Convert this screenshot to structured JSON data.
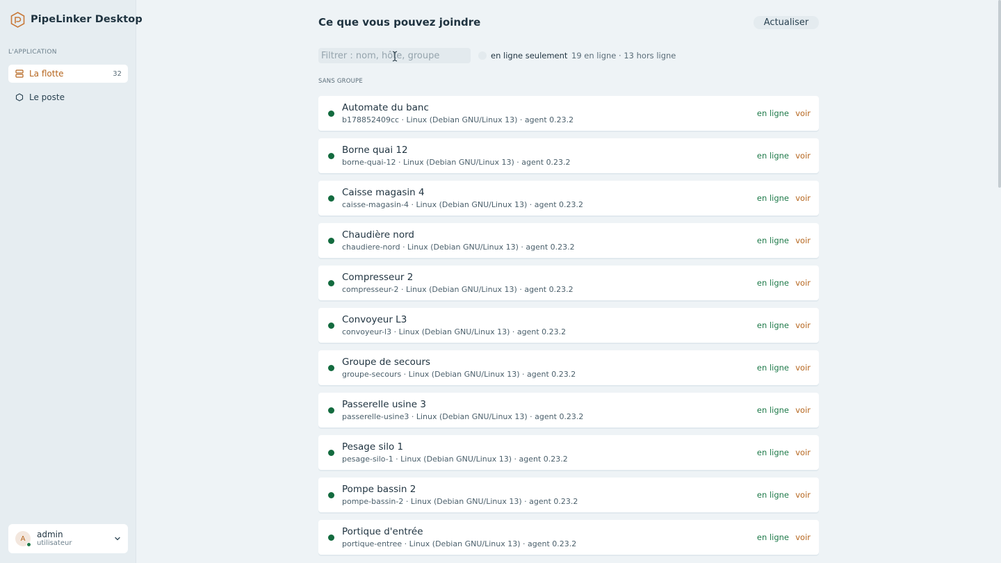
{
  "app": {
    "title": "PipeLinker Desktop"
  },
  "sidebar": {
    "section_label": "L'APPLICATION",
    "items": [
      {
        "label": "La flotte",
        "count": "32",
        "icon": "server-icon",
        "active": true
      },
      {
        "label": "Le poste",
        "icon": "hexagon-icon",
        "active": false
      }
    ],
    "user": {
      "initial": "A",
      "name": "admin",
      "role": "utilisateur"
    }
  },
  "main": {
    "title": "Ce que vous pouvez joindre",
    "refresh_label": "Actualiser",
    "filter": {
      "placeholder": "Filtrer : nom, hôte, groupe",
      "value": ""
    },
    "toggle_label": "en ligne seulement",
    "counts": "19 en ligne · 13 hors ligne",
    "group_header": "SANS GROUPE",
    "devices": [
      {
        "name": "Automate du banc",
        "meta": "b178852409cc · Linux (Debian GNU/Linux 13) · agent 0.23.2",
        "status": "en ligne",
        "action": "voir"
      },
      {
        "name": "Borne quai 12",
        "meta": "borne-quai-12 · Linux (Debian GNU/Linux 13) · agent 0.23.2",
        "status": "en ligne",
        "action": "voir"
      },
      {
        "name": "Caisse magasin 4",
        "meta": "caisse-magasin-4 · Linux (Debian GNU/Linux 13) · agent 0.23.2",
        "status": "en ligne",
        "action": "voir"
      },
      {
        "name": "Chaudière nord",
        "meta": "chaudiere-nord · Linux (Debian GNU/Linux 13) · agent 0.23.2",
        "status": "en ligne",
        "action": "voir"
      },
      {
        "name": "Compresseur 2",
        "meta": "compresseur-2 · Linux (Debian GNU/Linux 13) · agent 0.23.2",
        "status": "en ligne",
        "action": "voir"
      },
      {
        "name": "Convoyeur L3",
        "meta": "convoyeur-l3 · Linux (Debian GNU/Linux 13) · agent 0.23.2",
        "status": "en ligne",
        "action": "voir"
      },
      {
        "name": "Groupe de secours",
        "meta": "groupe-secours · Linux (Debian GNU/Linux 13) · agent 0.23.2",
        "status": "en ligne",
        "action": "voir"
      },
      {
        "name": "Passerelle usine 3",
        "meta": "passerelle-usine3 · Linux (Debian GNU/Linux 13) · agent 0.23.2",
        "status": "en ligne",
        "action": "voir"
      },
      {
        "name": "Pesage silo 1",
        "meta": "pesage-silo-1 · Linux (Debian GNU/Linux 13) · agent 0.23.2",
        "status": "en ligne",
        "action": "voir"
      },
      {
        "name": "Pompe bassin 2",
        "meta": "pompe-bassin-2 · Linux (Debian GNU/Linux 13) · agent 0.23.2",
        "status": "en ligne",
        "action": "voir"
      },
      {
        "name": "Portique d'entrée",
        "meta": "portique-entree · Linux (Debian GNU/Linux 13) · agent 0.23.2",
        "status": "en ligne",
        "action": "voir"
      }
    ]
  },
  "colors": {
    "accent": "#b5651d",
    "online": "#1f7a4a",
    "online_dot": "#136b3f"
  }
}
